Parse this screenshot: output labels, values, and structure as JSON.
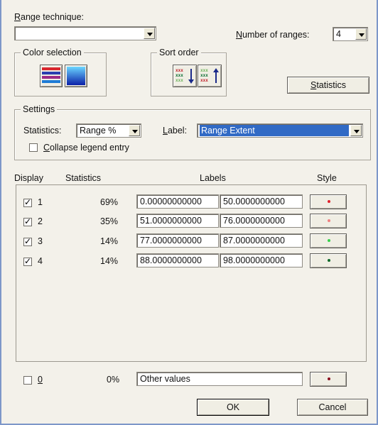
{
  "range_technique": {
    "label": "Range technique:",
    "value": ""
  },
  "number_of_ranges": {
    "label": "Number of ranges:",
    "value": "4"
  },
  "color_selection": {
    "title": "Color selection"
  },
  "sort_order": {
    "title": "Sort order"
  },
  "statistics_button": "Statistics",
  "settings": {
    "title": "Settings",
    "statistics_label": "Statistics:",
    "statistics_value": "Range %",
    "label_label": "Label:",
    "label_value": "Range Extent",
    "collapse_label": "Collapse legend entry",
    "collapse_checked": false
  },
  "columns": {
    "display": "Display",
    "statistics": "Statistics",
    "labels": "Labels",
    "style": "Style"
  },
  "rows": [
    {
      "checked": true,
      "index": "1",
      "stat": "69%",
      "from": "0.00000000000",
      "to": "50.0000000000",
      "color": "#e0212b"
    },
    {
      "checked": true,
      "index": "2",
      "stat": "35%",
      "from": "51.0000000000",
      "to": "76.0000000000",
      "color": "#f08080"
    },
    {
      "checked": true,
      "index": "3",
      "stat": "14%",
      "from": "77.0000000000",
      "to": "87.0000000000",
      "color": "#35d14a"
    },
    {
      "checked": true,
      "index": "4",
      "stat": "14%",
      "from": "88.0000000000",
      "to": "98.0000000000",
      "color": "#0f6a2a"
    }
  ],
  "other": {
    "checked": false,
    "index": "0",
    "stat": "0%",
    "label": "Other values",
    "color": "#8a1020"
  },
  "ok_button": "OK",
  "cancel_button": "Cancel"
}
